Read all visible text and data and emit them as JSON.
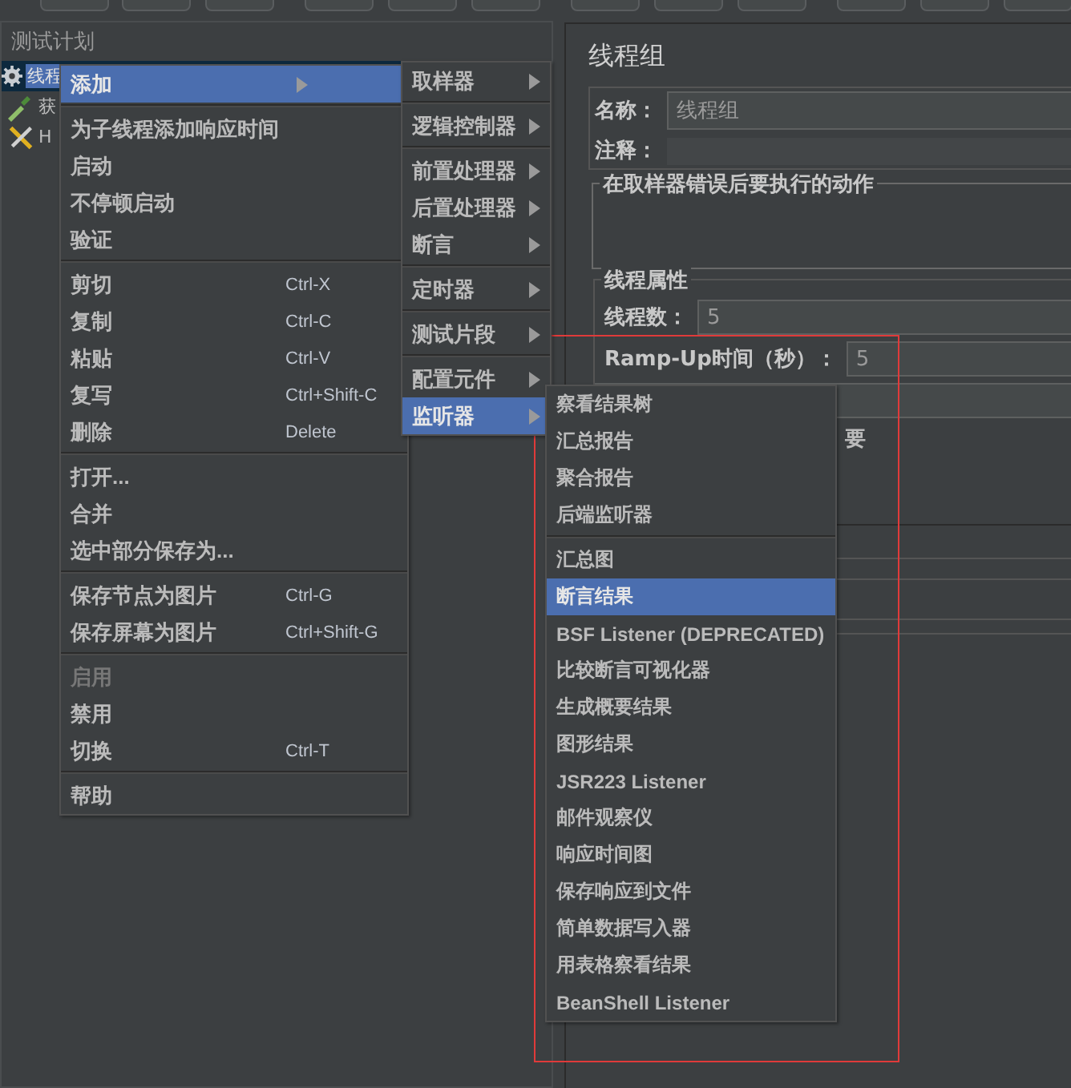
{
  "tree": {
    "header": "测试计划",
    "items": [
      {
        "label": "线程",
        "kind": "thread-group",
        "selected": true
      },
      {
        "label": "获",
        "kind": "sampler",
        "selected": false
      },
      {
        "label": "H",
        "kind": "config",
        "selected": false
      }
    ]
  },
  "properties": {
    "title": "线程组",
    "name_label": "名称：",
    "name_value": "线程组",
    "comment_label": "注释：",
    "error_group_title": "在取样器错误后要执行的动作",
    "thread_group_title": "线程属性",
    "fields": [
      {
        "label": "线程数：",
        "value": "5"
      },
      {
        "label": "Ramp-Up时间（秒）：",
        "value": "5"
      }
    ],
    "partial_text": "要"
  },
  "context_menu": {
    "items": [
      {
        "kind": "submenu",
        "label": "添加",
        "selected": true,
        "disabled": false
      },
      {
        "kind": "separator"
      },
      {
        "kind": "item",
        "label": "为子线程添加响应时间",
        "selected": false,
        "disabled": false
      },
      {
        "kind": "item",
        "label": "启动",
        "selected": false,
        "disabled": false
      },
      {
        "kind": "item",
        "label": "不停顿启动",
        "selected": false,
        "disabled": false
      },
      {
        "kind": "item",
        "label": "验证",
        "selected": false,
        "disabled": false
      },
      {
        "kind": "separator"
      },
      {
        "kind": "item",
        "label": "剪切",
        "shortcut": "Ctrl-X",
        "selected": false,
        "disabled": false
      },
      {
        "kind": "item",
        "label": "复制",
        "shortcut": "Ctrl-C",
        "selected": false,
        "disabled": false
      },
      {
        "kind": "item",
        "label": "粘贴",
        "shortcut": "Ctrl-V",
        "selected": false,
        "disabled": false
      },
      {
        "kind": "item",
        "label": "复写",
        "shortcut": "Ctrl+Shift-C",
        "selected": false,
        "disabled": false
      },
      {
        "kind": "item",
        "label": "删除",
        "shortcut": "Delete",
        "selected": false,
        "disabled": false
      },
      {
        "kind": "separator"
      },
      {
        "kind": "item",
        "label": "打开...",
        "selected": false,
        "disabled": false
      },
      {
        "kind": "item",
        "label": "合并",
        "selected": false,
        "disabled": false
      },
      {
        "kind": "item",
        "label": "选中部分保存为...",
        "selected": false,
        "disabled": false
      },
      {
        "kind": "separator"
      },
      {
        "kind": "item",
        "label": "保存节点为图片",
        "shortcut": "Ctrl-G",
        "selected": false,
        "disabled": false
      },
      {
        "kind": "item",
        "label": "保存屏幕为图片",
        "shortcut": "Ctrl+Shift-G",
        "selected": false,
        "disabled": false
      },
      {
        "kind": "separator"
      },
      {
        "kind": "item",
        "label": "启用",
        "selected": false,
        "disabled": true
      },
      {
        "kind": "item",
        "label": "禁用",
        "selected": false,
        "disabled": false
      },
      {
        "kind": "item",
        "label": "切换",
        "shortcut": "Ctrl-T",
        "selected": false,
        "disabled": false
      },
      {
        "kind": "separator"
      },
      {
        "kind": "item",
        "label": "帮助",
        "selected": false,
        "disabled": false
      }
    ]
  },
  "add_submenu": {
    "items": [
      {
        "kind": "submenu",
        "label": "取样器",
        "selected": false
      },
      {
        "kind": "separator"
      },
      {
        "kind": "submenu",
        "label": "逻辑控制器",
        "selected": false
      },
      {
        "kind": "separator"
      },
      {
        "kind": "submenu",
        "label": "前置处理器",
        "selected": false
      },
      {
        "kind": "submenu",
        "label": "后置处理器",
        "selected": false
      },
      {
        "kind": "submenu",
        "label": "断言",
        "selected": false
      },
      {
        "kind": "separator"
      },
      {
        "kind": "submenu",
        "label": "定时器",
        "selected": false
      },
      {
        "kind": "separator"
      },
      {
        "kind": "submenu",
        "label": "测试片段",
        "selected": false
      },
      {
        "kind": "separator"
      },
      {
        "kind": "submenu",
        "label": "配置元件",
        "selected": false
      },
      {
        "kind": "submenu",
        "label": "监听器",
        "selected": true
      }
    ]
  },
  "listener_submenu": {
    "items": [
      {
        "kind": "item",
        "label": "察看结果树",
        "selected": false
      },
      {
        "kind": "item",
        "label": "汇总报告",
        "selected": false
      },
      {
        "kind": "item",
        "label": "聚合报告",
        "selected": false
      },
      {
        "kind": "item",
        "label": "后端监听器",
        "selected": false
      },
      {
        "kind": "separator"
      },
      {
        "kind": "item",
        "label": "汇总图",
        "selected": false
      },
      {
        "kind": "item",
        "label": "断言结果",
        "selected": true
      },
      {
        "kind": "item",
        "label": "BSF Listener (DEPRECATED)",
        "selected": false
      },
      {
        "kind": "item",
        "label": "比较断言可视化器",
        "selected": false
      },
      {
        "kind": "item",
        "label": "生成概要结果",
        "selected": false
      },
      {
        "kind": "item",
        "label": "图形结果",
        "selected": false
      },
      {
        "kind": "item",
        "label": "JSR223 Listener",
        "selected": false
      },
      {
        "kind": "item",
        "label": "邮件观察仪",
        "selected": false
      },
      {
        "kind": "item",
        "label": "响应时间图",
        "selected": false
      },
      {
        "kind": "item",
        "label": "保存响应到文件",
        "selected": false
      },
      {
        "kind": "item",
        "label": "简单数据写入器",
        "selected": false
      },
      {
        "kind": "item",
        "label": "用表格察看结果",
        "selected": false
      },
      {
        "kind": "item",
        "label": "BeanShell Listener",
        "selected": false
      }
    ]
  }
}
